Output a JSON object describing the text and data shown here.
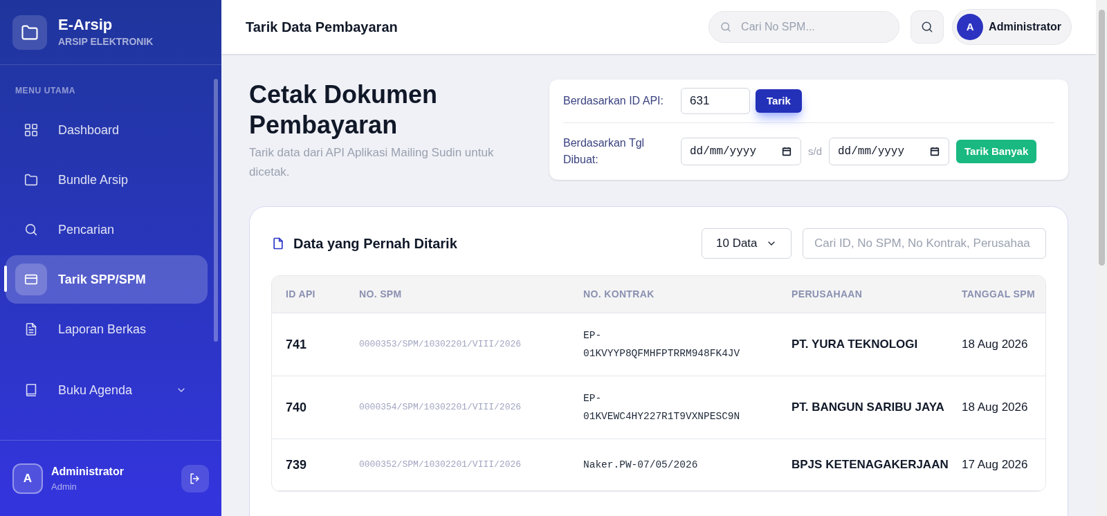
{
  "brand": {
    "title": "E-Arsip",
    "subtitle": "ARSIP ELEKTRONIK"
  },
  "sidebar": {
    "section": "MENU UTAMA",
    "items": [
      {
        "label": "Dashboard",
        "selected": false
      },
      {
        "label": "Bundle Arsip",
        "selected": false
      },
      {
        "label": "Pencarian",
        "selected": false
      },
      {
        "label": "Tarik SPP/SPM",
        "selected": true
      },
      {
        "label": "Laporan Berkas",
        "selected": false
      },
      {
        "label": "Buku Agenda",
        "selected": false,
        "expandable": true
      }
    ],
    "user": {
      "avatar": "A",
      "name": "Administrator",
      "role": "Admin"
    }
  },
  "header": {
    "title": "Tarik Data Pembayaran",
    "search": {
      "placeholder": "Cari No SPM..."
    },
    "user": {
      "avatar": "A",
      "name": "Administrator"
    }
  },
  "page": {
    "title": "Cetak Dokumen Pembayaran",
    "subtitle": "Tarik data dari API Aplikasi Mailing Sudin untuk dicetak."
  },
  "form": {
    "id_label": "Berdasarkan ID API:",
    "id_value": "631",
    "id_button": "Tarik",
    "date_label": "Berdasarkan Tgl Dibuat:",
    "date_from": "dd/mm/yyyy",
    "separator": "s/d",
    "date_to": "dd/mm/yyyy",
    "date_button": "Tarik Banyak"
  },
  "table_card": {
    "title": "Data yang Pernah Ditarik",
    "page_size": "10 Data",
    "search": {
      "placeholder": "Cari ID, No SPM, No Kontrak, Perusahaa"
    },
    "columns": [
      "ID API",
      "NO. SPM",
      "NO. KONTRAK",
      "PERUSAHAAN",
      "TANGGAL SPM"
    ],
    "rows": [
      [
        "741",
        "0000353/SPM/10302201/VIII/2026",
        "EP-01KVYYP8QFMHFPTRRM948FK4JV",
        "PT. YURA TEKNOLOGI",
        "18 Aug 2026"
      ],
      [
        "740",
        "0000354/SPM/10302201/VIII/2026",
        "EP-01KVEWC4HY227R1T9VXNPESC9N",
        "PT. BANGUN SARIBU JAYA",
        "18 Aug 2026"
      ],
      [
        "739",
        "0000352/SPM/10302201/VIII/2026",
        "Naker.PW-07/05/2026",
        "BPJS KETENAGAKERJAAN",
        "17 Aug 2026"
      ]
    ]
  }
}
